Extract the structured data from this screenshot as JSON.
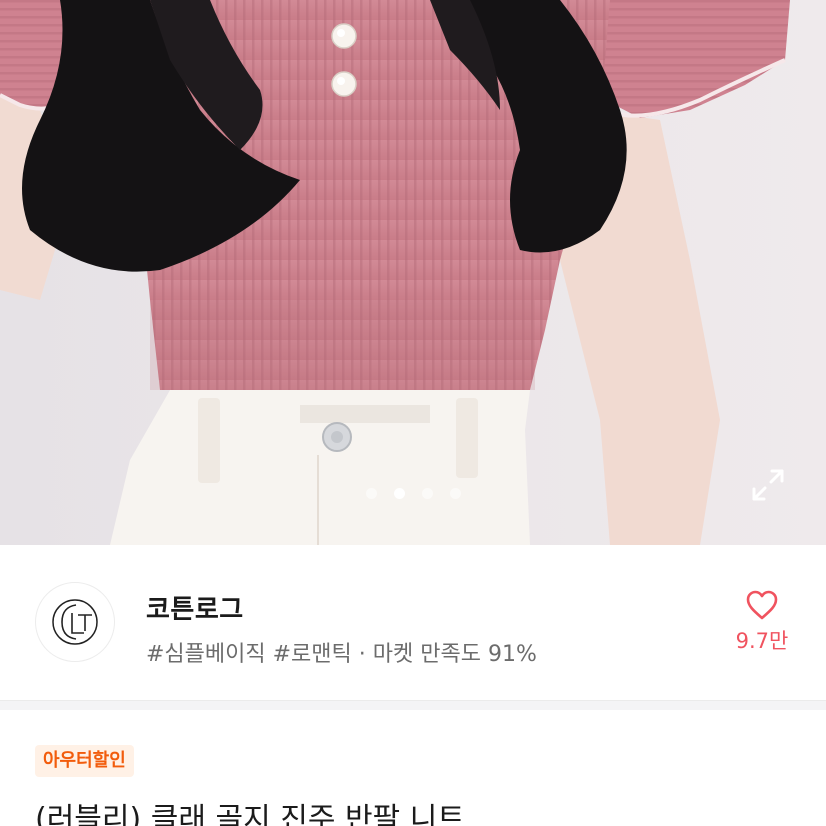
{
  "hero": {
    "image_description_icon": "product-photo-pink-knit-top",
    "carousel": {
      "total": 4,
      "active_index": 1
    },
    "expand_icon": "expand-icon"
  },
  "shop": {
    "logo_text": "CLT",
    "name": "코튼로그",
    "tags": "#심플베이직 #로맨틱 · 마켓 만족도 91%",
    "like_icon": "heart-outline-icon",
    "like_count": "9.7만"
  },
  "product": {
    "badge": "아우터할인",
    "title": "(러블리) 클래 골지 진주 반팔 니트"
  },
  "colors": {
    "accent": "#f0535f",
    "badge_bg": "#fff1e6",
    "badge_text": "#f25c0c",
    "knit_pink": "#cf8490"
  }
}
